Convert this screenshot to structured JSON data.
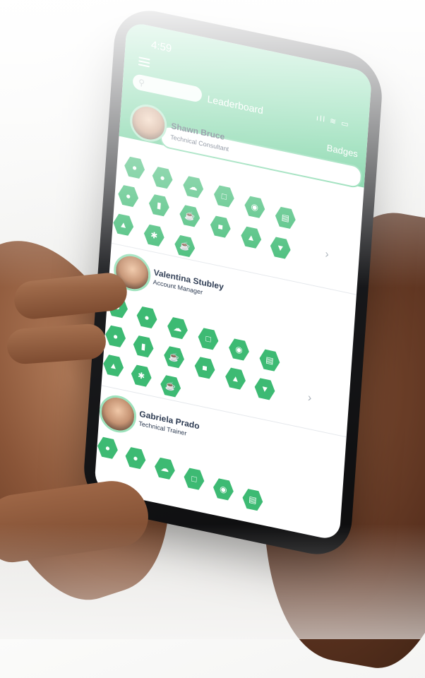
{
  "status": {
    "time": "4:59",
    "icons": "ıll ≋ ▭"
  },
  "header": {
    "title": "Leaderboard",
    "badges_label": "Badges",
    "search_icon": "search-icon",
    "menu_icon": "hamburger-menu-icon"
  },
  "users": [
    {
      "name": "Shawn Bruce",
      "role": "Technical Consultant"
    },
    {
      "name": "Valentina Stubley",
      "role": "Account Manager"
    },
    {
      "name": "Gabriela Prado",
      "role": "Technical Trainer"
    }
  ],
  "badge_icons": [
    "person-icon",
    "group-icon",
    "cloud-icon",
    "chat-icon",
    "camera-icon",
    "document-icon",
    "bottle-icon",
    "cup-icon",
    "message-icon",
    "pyramid-icon",
    "sparkle-icon",
    "coffee-icon",
    "pin-icon",
    "cocktail-icon"
  ],
  "colors": {
    "accent": "#4fc485",
    "badge": "#3dba73",
    "text": "#2d3b52"
  }
}
